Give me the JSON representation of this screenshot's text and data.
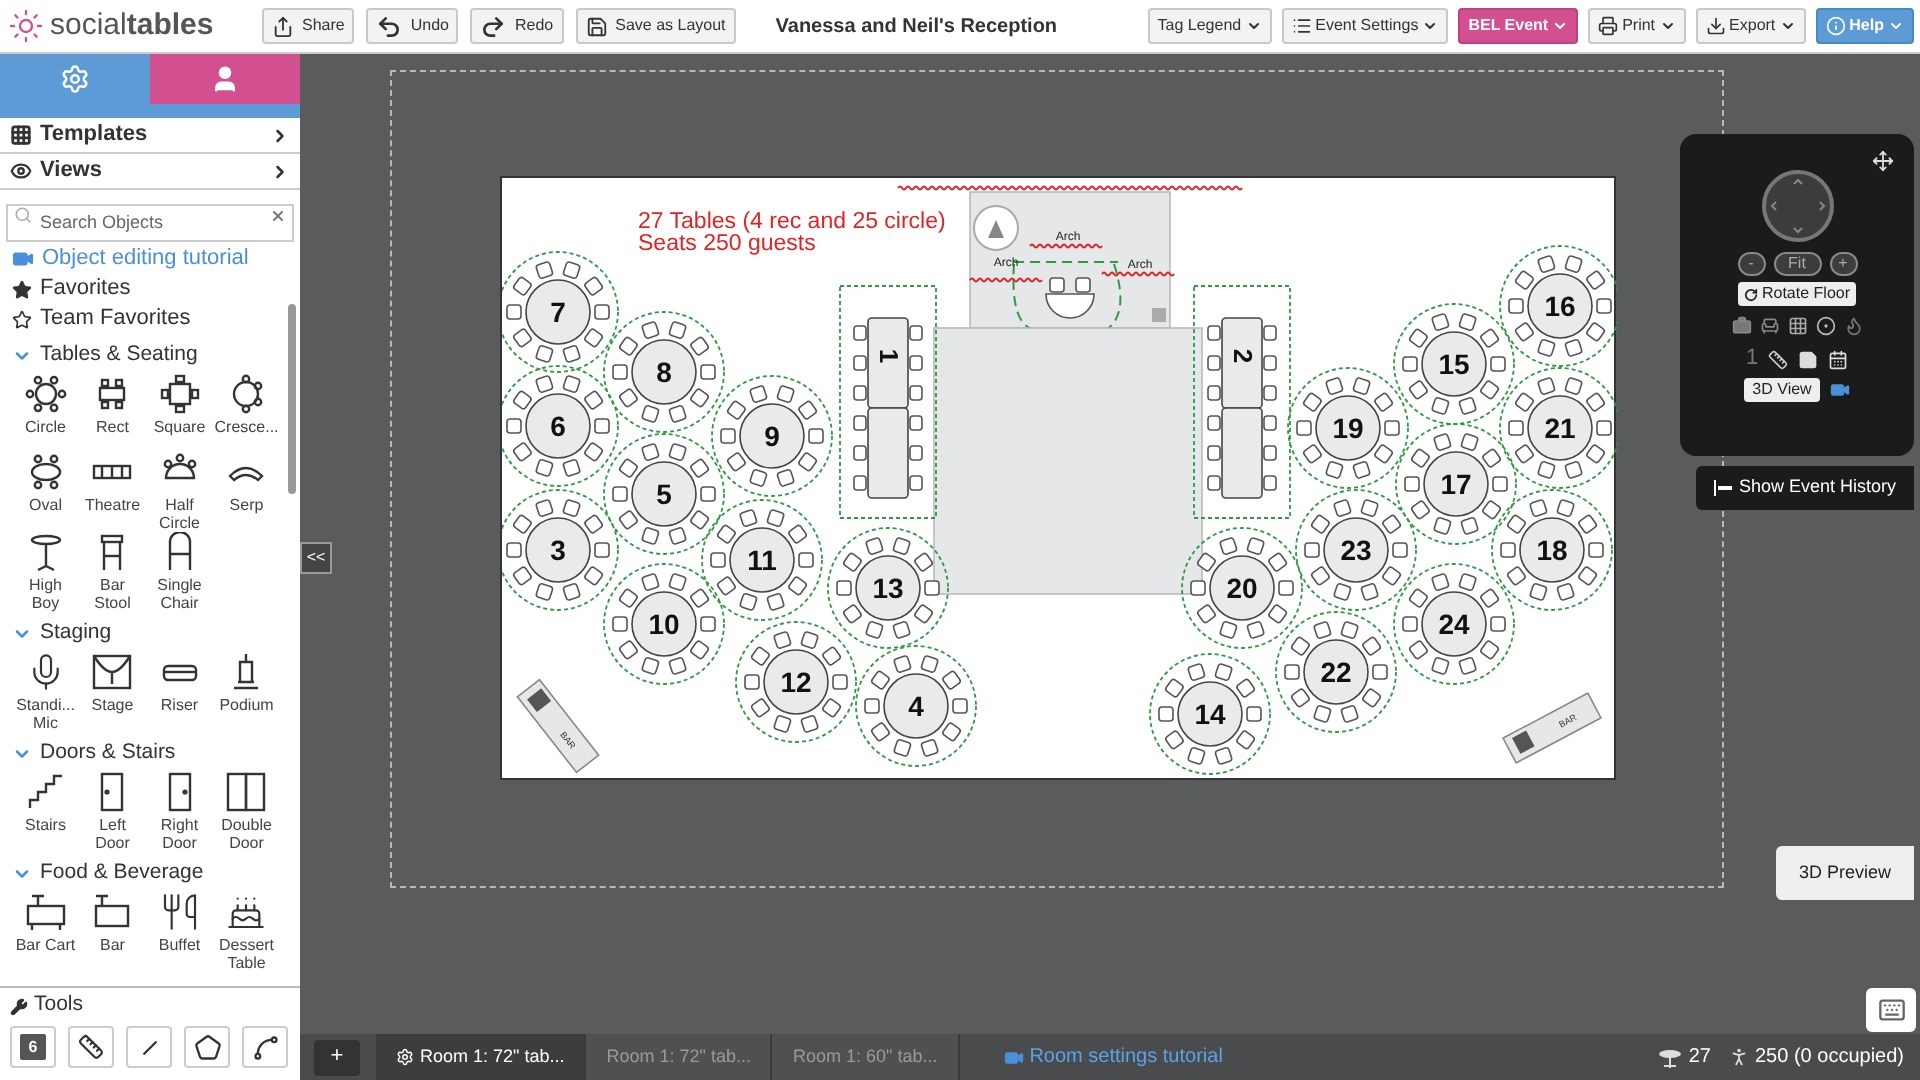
{
  "topbar": {
    "logo": "social**tables**",
    "buttons": [
      {
        "label": "Share"
      },
      {
        "label": "Undo"
      },
      {
        "label": "Redo"
      },
      {
        "label": "Save as Layout"
      }
    ],
    "title": "Vanessa and Neil's Reception",
    "menus": [
      {
        "label": "Tag Legend",
        "kind": "plain"
      },
      {
        "label": "Event Settings",
        "kind": "settings"
      },
      {
        "label": "BEL Event",
        "kind": "event"
      },
      {
        "label": "Print",
        "kind": "print"
      },
      {
        "label": "Export",
        "kind": "export"
      },
      {
        "label": "Help",
        "kind": "help"
      }
    ]
  },
  "sidebar": {
    "tabs": [
      {
        "selected": true
      },
      {
        "selected": false
      }
    ],
    "sections": [
      {
        "label": "Templates"
      },
      {
        "label": "Views"
      }
    ],
    "search": {
      "placeholder": "Search Objects"
    },
    "links": [
      {
        "label": "Object editing tutorial",
        "kind": "video"
      },
      {
        "label": "Favorites",
        "kind": "star"
      },
      {
        "label": "Team Favorites",
        "kind": "stars"
      }
    ],
    "categories": [
      {
        "title": "Tables & Seating",
        "expanded": true,
        "items": [
          "Circle",
          "Rect",
          "Square",
          "Cresce...",
          "Oval",
          "Theatre",
          "Half Circle",
          "Serp",
          "High Boy",
          "Bar Stool",
          "Single Chair"
        ]
      },
      {
        "title": "Staging",
        "expanded": true,
        "items": [
          "Standi... Mic",
          "Stage",
          "Riser",
          "Podium"
        ]
      },
      {
        "title": "Doors & Stairs",
        "expanded": true,
        "items": [
          "Stairs",
          "Left Door",
          "Right Door",
          "Double Door"
        ]
      },
      {
        "title": "Food & Beverage",
        "expanded": true,
        "items": [
          "Bar Cart",
          "Bar",
          "Buffet",
          "Dessert Table"
        ]
      }
    ],
    "tools": {
      "title": "Tools",
      "counter": "6"
    }
  },
  "canvas": {
    "note": [
      "27 Tables (4 rec and 25 circle)",
      "Seats 250 guests"
    ],
    "arch_labels": [
      "Arch",
      "Arch",
      "Arch"
    ],
    "bar_labels": [
      "BAR",
      "BAR"
    ],
    "tables": [
      {
        "label": "1",
        "kind": "rect"
      },
      {
        "label": "2",
        "kind": "rect"
      },
      {
        "label": "7",
        "kind": "round"
      },
      {
        "label": "8",
        "kind": "round"
      },
      {
        "label": "6",
        "kind": "round"
      },
      {
        "label": "9",
        "kind": "round"
      },
      {
        "label": "5",
        "kind": "round"
      },
      {
        "label": "3",
        "kind": "round"
      },
      {
        "label": "11",
        "kind": "round"
      },
      {
        "label": "13",
        "kind": "round"
      },
      {
        "label": "10",
        "kind": "round"
      },
      {
        "label": "12",
        "kind": "round"
      },
      {
        "label": "4",
        "kind": "round"
      },
      {
        "label": "20",
        "kind": "round"
      },
      {
        "label": "14",
        "kind": "round"
      },
      {
        "label": "19",
        "kind": "round"
      },
      {
        "label": "15",
        "kind": "round"
      },
      {
        "label": "16",
        "kind": "round"
      },
      {
        "label": "21",
        "kind": "round"
      },
      {
        "label": "17",
        "kind": "round"
      },
      {
        "label": "23",
        "kind": "round"
      },
      {
        "label": "18",
        "kind": "round"
      },
      {
        "label": "24",
        "kind": "round"
      },
      {
        "label": "22",
        "kind": "round"
      }
    ],
    "collapse": "<<"
  },
  "controls": {
    "zoom_out": "-",
    "fit": "Fit",
    "zoom_in": "+",
    "rotate": "Rotate Floor",
    "floor_number": "1",
    "view_3d": "3D View"
  },
  "history_button": "Show Event History",
  "preview_button": "3D Preview",
  "bottom": {
    "add": "+",
    "tabs": [
      {
        "label": "Room 1: 72\" tab...",
        "selected": true
      },
      {
        "label": "Room 1: 72\" tab...",
        "selected": false
      },
      {
        "label": "Room 1: 60\" tab...",
        "selected": false
      }
    ],
    "tutorial": "Room settings tutorial",
    "table_count": "27",
    "guest_count": "250 (0 occupied)"
  }
}
